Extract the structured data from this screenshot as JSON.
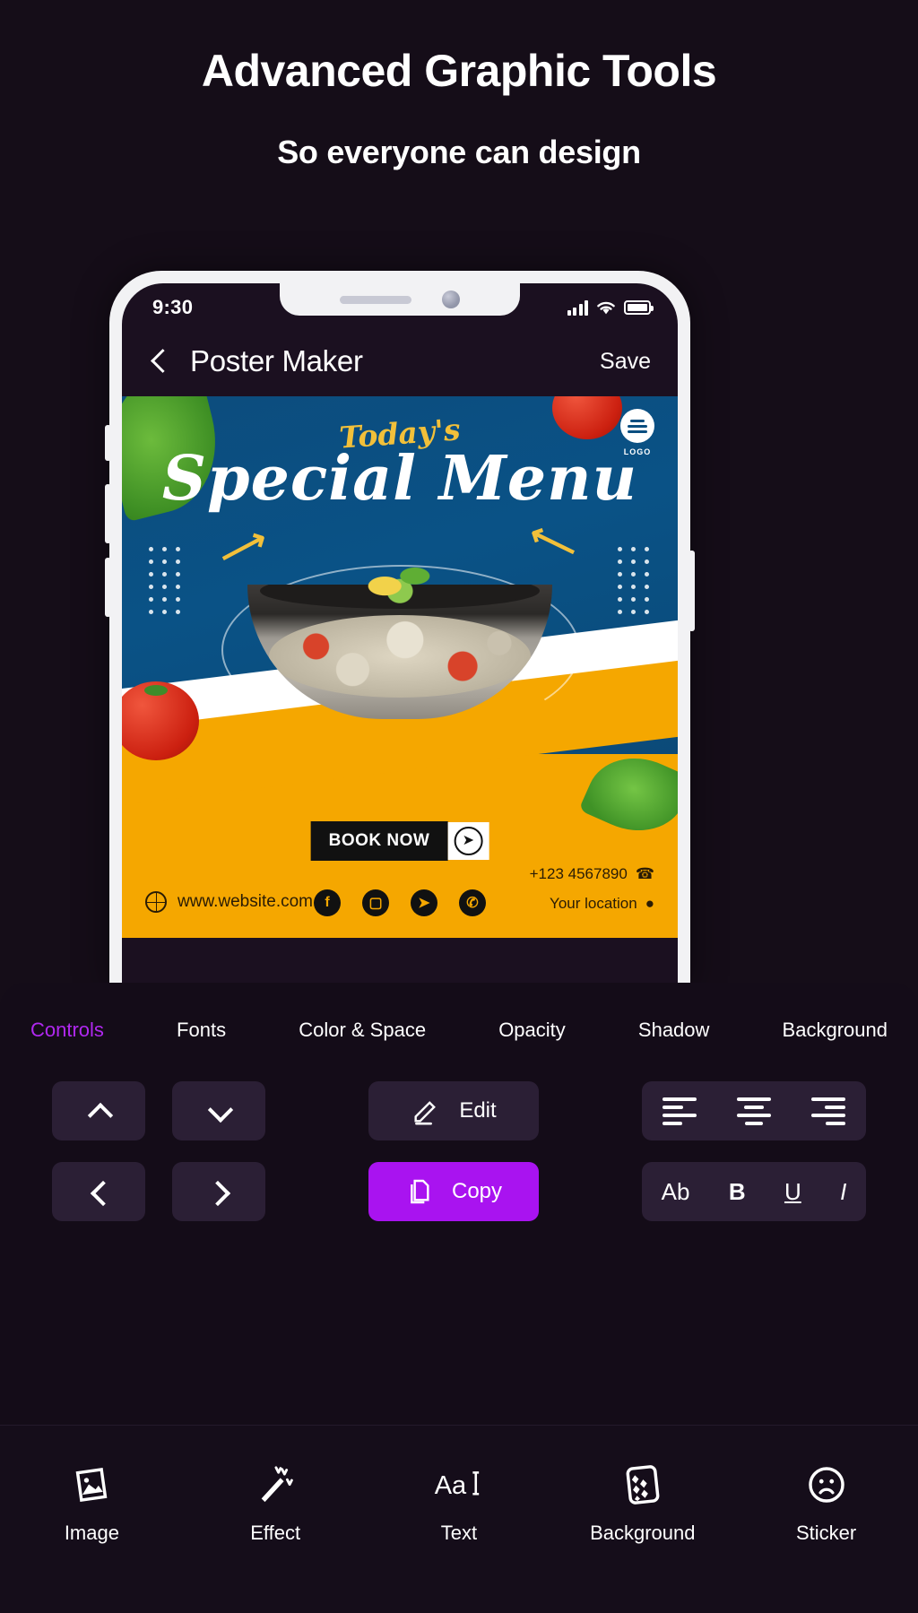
{
  "promo": {
    "title": "Advanced Graphic Tools",
    "subtitle": "So everyone can design"
  },
  "phone": {
    "status": {
      "time": "9:30",
      "signal_icon": "signal-bars-icon",
      "wifi_icon": "wifi-icon",
      "battery_icon": "battery-full-icon"
    },
    "header": {
      "back_icon": "back-chevron-icon",
      "title": "Poster Maker",
      "save_label": "Save"
    }
  },
  "poster": {
    "eyebrow": "Today's",
    "headline": "Special Menu",
    "logo_label": "LOGO",
    "cta": {
      "label": "BOOK NOW",
      "arrow_icon": "play-arrow-icon"
    },
    "website": {
      "icon": "globe-icon",
      "text": "www.website.com"
    },
    "socials": [
      {
        "name": "facebook-icon",
        "glyph": "f"
      },
      {
        "name": "instagram-icon",
        "glyph": "▢"
      },
      {
        "name": "twitter-icon",
        "glyph": "➤"
      },
      {
        "name": "whatsapp-icon",
        "glyph": "✆"
      }
    ],
    "contact": {
      "phone": "+123 4567890",
      "phone_icon": "phone-icon",
      "location": "Your location",
      "location_icon": "map-pin-icon"
    },
    "colors": {
      "top": "#0a5286",
      "bottom": "#f5a700",
      "accent_gold": "#f2c03a"
    }
  },
  "editor": {
    "tabs": [
      {
        "label": "Controls",
        "active": true
      },
      {
        "label": "Fonts",
        "active": false
      },
      {
        "label": "Color & Space",
        "active": false
      },
      {
        "label": "Opacity",
        "active": false
      },
      {
        "label": "Shadow",
        "active": false
      },
      {
        "label": "Background",
        "active": false
      }
    ],
    "active_color": "#b028f0",
    "controls": {
      "move_up_icon": "chevron-up-icon",
      "move_down_icon": "chevron-down-icon",
      "move_left_icon": "chevron-left-icon",
      "move_right_icon": "chevron-right-icon",
      "edit_label": "Edit",
      "edit_icon": "pencil-icon",
      "copy_label": "Copy",
      "copy_icon": "copy-icon",
      "copy_color": "#a913f0",
      "align_left_icon": "align-left-icon",
      "align_center_icon": "align-center-icon",
      "align_right_icon": "align-right-icon",
      "case_label": "Ab",
      "bold_label": "B",
      "underline_label": "U",
      "italic_label": "I"
    }
  },
  "bottom_nav": [
    {
      "label": "Image",
      "icon": "image-icon"
    },
    {
      "label": "Effect",
      "icon": "magic-wand-icon"
    },
    {
      "label": "Text",
      "icon": "text-aa-icon"
    },
    {
      "label": "Background",
      "icon": "background-pattern-icon"
    },
    {
      "label": "Sticker",
      "icon": "sticker-face-icon"
    }
  ]
}
